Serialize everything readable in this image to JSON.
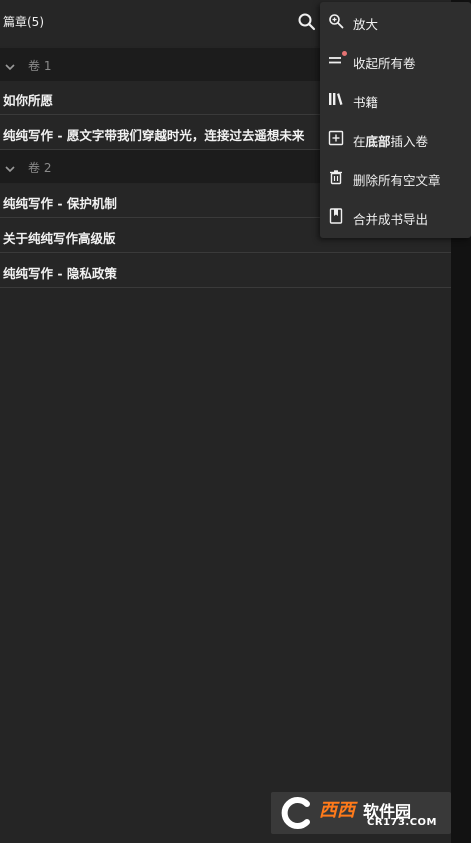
{
  "header": {
    "title": "篇章(5)"
  },
  "volumes": [
    {
      "label": "卷 1",
      "chapters": [
        "如你所愿",
        "纯纯写作 - 愿文字带我们穿越时光，连接过去遥想未来"
      ]
    },
    {
      "label": "卷 2",
      "chapters": [
        "纯纯写作 - 保护机制",
        "关于纯纯写作高级版",
        "纯纯写作 - 隐私政策"
      ]
    }
  ],
  "menu": {
    "items": [
      {
        "label": "放大",
        "icon": "zoom-in-icon"
      },
      {
        "label": "收起所有卷",
        "icon": "collapse-lines-icon",
        "badge": true
      },
      {
        "label": "书籍",
        "icon": "library-icon"
      },
      {
        "label": "在底部插入卷",
        "icon": "add-box-icon",
        "parts": [
          "在",
          "底部",
          "插入卷"
        ]
      },
      {
        "label": "删除所有空文章",
        "icon": "trash-icon"
      },
      {
        "label": "合并成书导出",
        "icon": "bookmark-icon"
      }
    ]
  },
  "watermark": {
    "brand": "西西",
    "tagline": "软件园",
    "url": "CR173.COM"
  },
  "colors": {
    "background": "#252525",
    "volume_bar": "#1c1c1c",
    "menu": "#2e2e2e",
    "badge": "#e57373",
    "watermark_accent": "#ff7a1a"
  }
}
